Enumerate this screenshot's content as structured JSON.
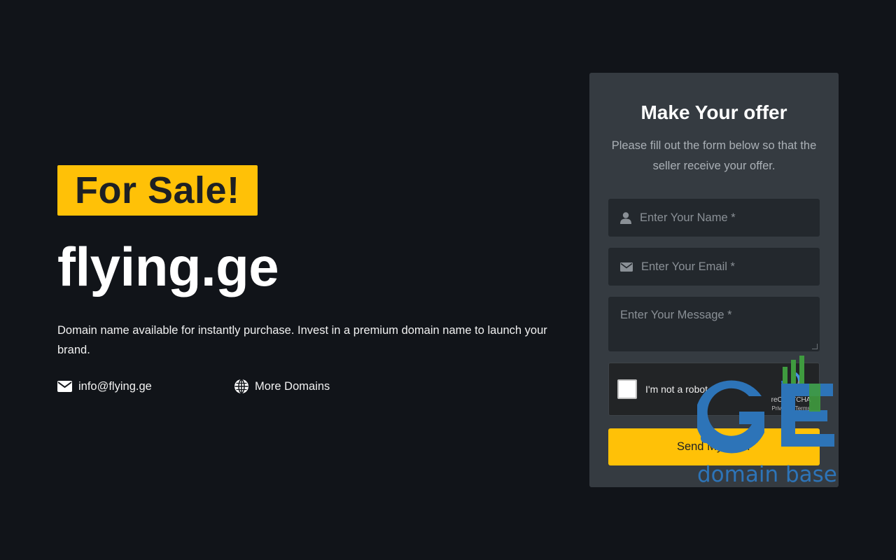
{
  "hero": {
    "badge": "For Sale!",
    "domain": "flying.ge",
    "description": "Domain name available for instantly purchase. Invest in a premium domain name to launch your brand.",
    "email": "info@flying.ge",
    "more_domains": "More Domains"
  },
  "form": {
    "title": "Make Your offer",
    "subtitle": "Please fill out the form below so that the seller receive your offer.",
    "name_placeholder": "Enter Your Name *",
    "email_placeholder": "Enter Your Email *",
    "message_placeholder": "Enter Your Message *",
    "recaptcha": {
      "label": "I'm not a robot",
      "brand": "reCAPTCHA",
      "links": "Privacy - Terms"
    },
    "submit_label": "Send My Offer"
  },
  "watermark": {
    "logo_text": "GE",
    "tagline": "domain base"
  },
  "colors": {
    "background": "#111419",
    "accent": "#ffc107",
    "card": "#353b41",
    "input": "#23282d",
    "watermark_blue": "#2d74b8",
    "watermark_green": "#3f9b3f"
  }
}
